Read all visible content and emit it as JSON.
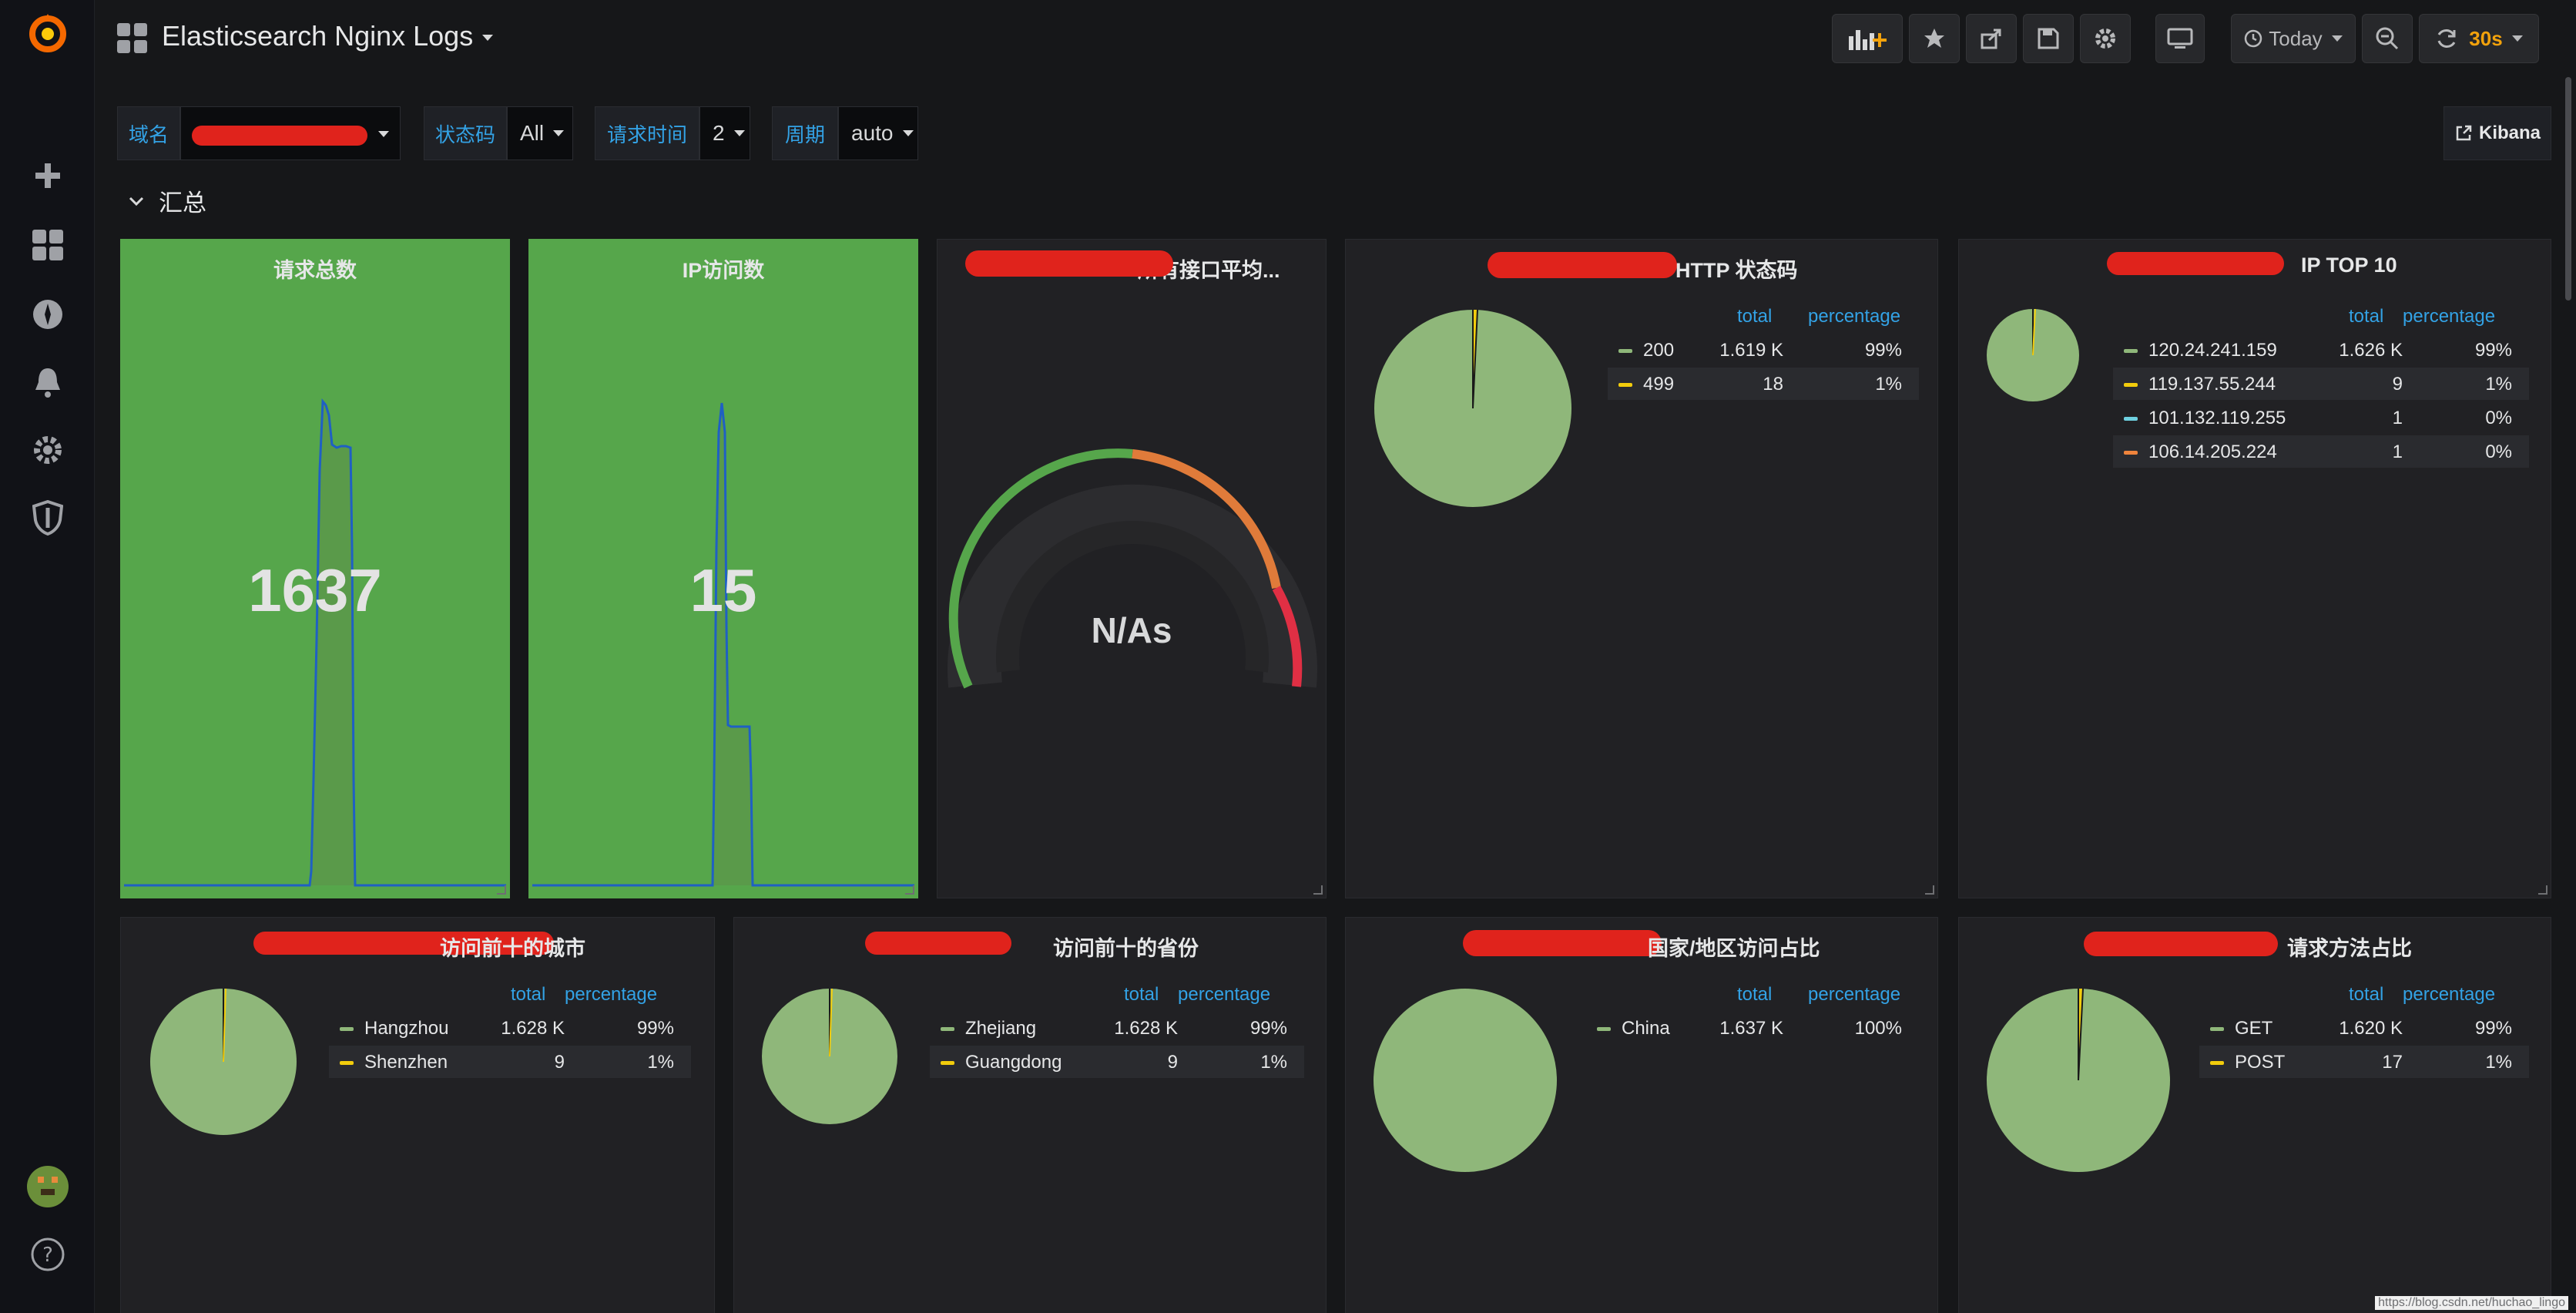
{
  "colors": {
    "accent_blue": "#33a2e5",
    "green": "#56a64b",
    "pie_green": "#8fb77a",
    "yellow": "#f2cc0c",
    "orange": "#ff780a",
    "red": "#e02f44",
    "cyan": "#8ab8ff"
  },
  "header": {
    "title": "Elasticsearch Nginx Logs",
    "time_range": "Today",
    "refresh": "30s"
  },
  "toolbar": {
    "icons": [
      "add-panel-icon",
      "star-icon",
      "share-icon",
      "save-icon",
      "gear-icon",
      "tv-icon",
      "clock-icon",
      "zoom-out-icon",
      "refresh-icon"
    ]
  },
  "sidebar": {
    "icons": [
      "grafana-logo-icon",
      "plus-icon",
      "dashboards-icon",
      "explore-icon",
      "bell-icon",
      "gear-icon",
      "shield-icon",
      "avatar",
      "help-icon"
    ]
  },
  "variables": [
    {
      "label": "域名",
      "value": ""
    },
    {
      "label": "状态码",
      "value": "All"
    },
    {
      "label": "请求时间",
      "value": "2"
    },
    {
      "label": "周期",
      "value": "auto"
    }
  ],
  "kibana_link": "Kibana",
  "row_title": "汇总",
  "stat_panels": [
    {
      "title": "请求总数",
      "value": "1637"
    },
    {
      "title": "IP访问数",
      "value": "15"
    }
  ],
  "gauge_panel": {
    "title": "所有接口平均...",
    "value": "N/As"
  },
  "legend_headers": {
    "total": "total",
    "percentage": "percentage"
  },
  "pie_panels": [
    {
      "title": "HTTP 状态码",
      "rows": [
        {
          "name": "200",
          "total": "1.619 K",
          "pct": "99%",
          "color": "#8fb77a"
        },
        {
          "name": "499",
          "total": "18",
          "pct": "1%",
          "color": "#f2cc0c"
        }
      ]
    },
    {
      "title": "IP TOP 10",
      "rows": [
        {
          "name": "120.24.241.159",
          "total": "1.626 K",
          "pct": "99%",
          "color": "#8fb77a"
        },
        {
          "name": "119.137.55.244",
          "total": "9",
          "pct": "1%",
          "color": "#f2cc0c"
        },
        {
          "name": "101.132.119.255",
          "total": "1",
          "pct": "0%",
          "color": "#6ed0e0"
        },
        {
          "name": "106.14.205.224",
          "total": "1",
          "pct": "0%",
          "color": "#ef843c"
        }
      ]
    },
    {
      "title": "访问前十的城市",
      "rows": [
        {
          "name": "Hangzhou",
          "total": "1.628 K",
          "pct": "99%",
          "color": "#8fb77a"
        },
        {
          "name": "Shenzhen",
          "total": "9",
          "pct": "1%",
          "color": "#f2cc0c"
        }
      ]
    },
    {
      "title": "访问前十的省份",
      "rows": [
        {
          "name": "Zhejiang",
          "total": "1.628 K",
          "pct": "99%",
          "color": "#8fb77a"
        },
        {
          "name": "Guangdong",
          "total": "9",
          "pct": "1%",
          "color": "#f2cc0c"
        }
      ]
    },
    {
      "title": "国家/地区访问占比",
      "rows": [
        {
          "name": "China",
          "total": "1.637 K",
          "pct": "100%",
          "color": "#8fb77a"
        }
      ]
    },
    {
      "title": "请求方法占比",
      "rows": [
        {
          "name": "GET",
          "total": "1.620 K",
          "pct": "99%",
          "color": "#8fb77a"
        },
        {
          "name": "POST",
          "total": "17",
          "pct": "1%",
          "color": "#f2cc0c"
        }
      ]
    }
  ],
  "watermark": "https://blog.csdn.net/huchao_lingo"
}
